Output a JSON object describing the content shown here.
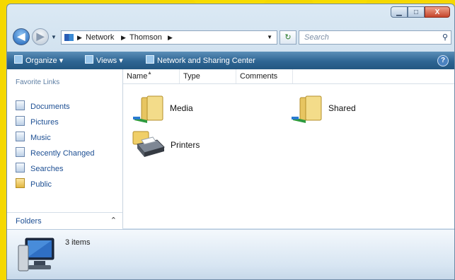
{
  "window": {
    "title": ""
  },
  "caption_buttons": {
    "minimize": "▁",
    "maximize": "□",
    "close": "X"
  },
  "nav": {
    "breadcrumb": [
      "Network",
      "Thomson"
    ],
    "search_placeholder": "Search"
  },
  "toolbar": {
    "organize": "Organize",
    "views": "Views",
    "network_sharing": "Network and Sharing Center",
    "help": "?"
  },
  "favorite_links": {
    "header": "Favorite Links",
    "items": [
      "Documents",
      "Pictures",
      "Music",
      "Recently Changed",
      "Searches",
      "Public"
    ]
  },
  "folders_bar": {
    "label": "Folders"
  },
  "columns": [
    "Name",
    "Type",
    "Comments"
  ],
  "items": [
    {
      "name": "Media",
      "icon": "shared-folder-icon"
    },
    {
      "name": "Shared",
      "icon": "shared-folder-icon"
    },
    {
      "name": "Printers",
      "icon": "printer-folder-icon"
    }
  ],
  "details": {
    "count": "3 items",
    "icon": "network-computer-icon"
  },
  "colors": {
    "toolbar": "#2e6593",
    "link": "#1d4f93",
    "background": "#f5d800"
  }
}
